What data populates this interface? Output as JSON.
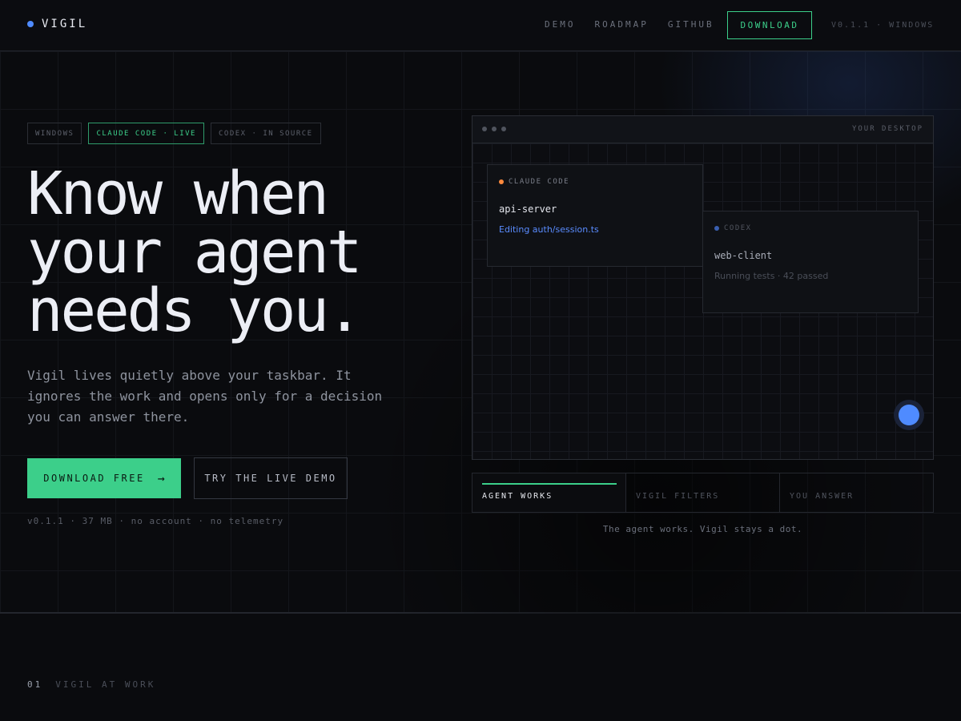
{
  "nav": {
    "brand": "VIGIL",
    "links": [
      "DEMO",
      "ROADMAP",
      "GITHUB"
    ],
    "download": "DOWNLOAD",
    "version": "V0.1.1 · WINDOWS"
  },
  "hero": {
    "tags": [
      "WINDOWS",
      "CLAUDE CODE · LIVE",
      "CODEX · IN SOURCE"
    ],
    "headline": [
      "Know when",
      "your agent",
      "needs you."
    ],
    "subtitle": "Vigil lives quietly above your taskbar. It ignores the work and opens only for a decision you can answer there.",
    "primary_button": "DOWNLOAD FREE",
    "primary_arrow": "→",
    "secondary_button": "TRY THE LIVE DEMO",
    "meta": "v0.1.1 · 37 MB · no account · no telemetry"
  },
  "desktop": {
    "label": "YOUR DESKTOP",
    "cards": [
      {
        "agent": "CLAUDE CODE",
        "project": "api-server",
        "status": "Editing auth/session.ts",
        "dot_color": "#ff8a3d",
        "status_color": "#5a8cff"
      },
      {
        "agent": "CODEX",
        "project": "web-client",
        "status": "Running tests · 42 passed",
        "dot_color": "#3a5fb0",
        "status_color": "#4a4e58"
      }
    ]
  },
  "steps": {
    "items": [
      "AGENT WORKS",
      "VIGIL FILTERS",
      "YOU ANSWER"
    ],
    "caption": "The agent works. Vigil stays a dot."
  },
  "section": {
    "number": "01",
    "title": "VIGIL AT WORK"
  },
  "colors": {
    "accent_green": "#3ccf8a",
    "accent_blue": "#4f8bff",
    "background": "#0a0b0e"
  }
}
